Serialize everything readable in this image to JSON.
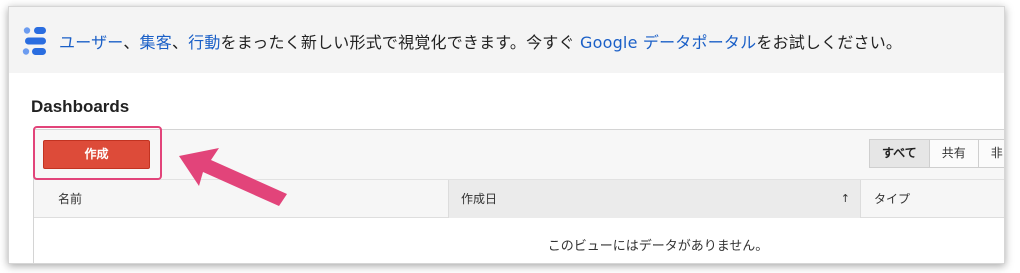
{
  "banner": {
    "parts": [
      {
        "text": "ユーザー",
        "link": true
      },
      {
        "text": "、",
        "link": false
      },
      {
        "text": "集客",
        "link": true
      },
      {
        "text": "、",
        "link": false
      },
      {
        "text": "行動",
        "link": true
      },
      {
        "text": "をまったく新しい形式で視覚化できます。今すぐ ",
        "link": false
      },
      {
        "text": "Google データポータル",
        "link": true
      },
      {
        "text": "をお試しください。",
        "link": false
      }
    ],
    "logo_icon": "data-studio-logo-icon"
  },
  "page_title": "Dashboards",
  "toolbar": {
    "create_label": "作成",
    "filters": [
      {
        "label": "すべて",
        "active": true
      },
      {
        "label": "共有",
        "active": false
      },
      {
        "label": "非",
        "active": false
      }
    ]
  },
  "table": {
    "columns": [
      {
        "label": "名前"
      },
      {
        "label": "作成日",
        "sort_icon": "↑"
      },
      {
        "label": "タイプ"
      }
    ],
    "empty_message": "このビューにはデータがありません。"
  },
  "colors": {
    "accent_red": "#dd4b39",
    "link_blue": "#1a5fc7",
    "annotation_pink": "#e2447a"
  }
}
